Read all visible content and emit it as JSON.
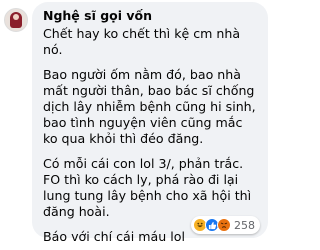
{
  "comment": {
    "author": "Nghệ sĩ gọi vốn",
    "paragraphs": [
      "Chết hay ko chết thì kệ cm nhà nó.",
      "Bao người ốm nằm đó, bao nhà mất người thân, bao bác sĩ chống dịch lây nhiễm bệnh cũng hi sinh, bao tình nguyện viên cũng mắc ko qua khỏi thì đéo đăng.",
      "Có mỗi cái con lol 3/, phản trắc. FO thì ko cách ly, phá rào đi lại lung tung lây bệnh cho xã hội thì đăng hoài.",
      "Báo với chí cái máu lol"
    ],
    "reactions": {
      "icons": [
        "haha-icon",
        "like-icon",
        "angry-icon"
      ],
      "count": "258"
    }
  },
  "colors": {
    "bubble": "#f0f2f5",
    "text": "#050505",
    "meta": "#65676b"
  }
}
